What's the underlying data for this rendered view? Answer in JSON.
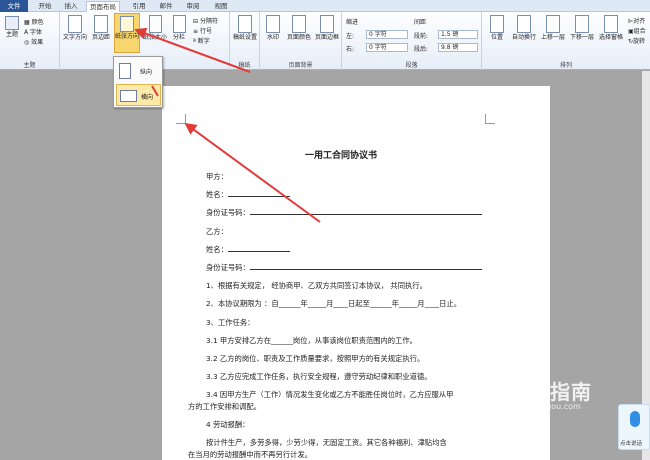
{
  "tabs": [
    "文件",
    "开始",
    "插入",
    "页面布局",
    "引用",
    "邮件",
    "审阅",
    "视图"
  ],
  "ribbon": {
    "theme_group": {
      "label": "主题",
      "theme_btn": "主题",
      "colors": "颜色",
      "fonts": "字体",
      "effects": "效果"
    },
    "page_setup_group": {
      "label": "页面设置",
      "text_direction": "文字方向",
      "margins": "页边距",
      "orientation": "纸张方向",
      "size": "纸张大小",
      "columns": "分栏",
      "breaks": "分隔符",
      "line_numbers": "行号",
      "hyphenation": "断字"
    },
    "manuscript_group": {
      "label": "稿纸",
      "btn": "稿纸设置"
    },
    "page_bg_group": {
      "label": "页面背景",
      "watermark": "水印",
      "page_color": "页面颜色",
      "page_border": "页面边框"
    },
    "paragraph_group": {
      "label": "段落",
      "indent_label": "缩进",
      "spacing_label": "间距",
      "left_label": "左:",
      "left_value": "0 字符",
      "right_label": "右:",
      "right_value": "0 字符",
      "before_label": "段前:",
      "before_value": "1.5 磅",
      "after_label": "段后:",
      "after_value": "9.8 磅"
    },
    "arrange_group": {
      "label": "排列",
      "position": "位置",
      "wrap": "自动换行",
      "bring_forward": "上移一层",
      "send_backward": "下移一层",
      "selection_pane": "选择窗格",
      "align": "对齐",
      "group": "组合",
      "rotate": "旋转"
    }
  },
  "orientation_menu": {
    "portrait": "纵向",
    "landscape": "横向"
  },
  "document": {
    "title": "一用工合同协议书",
    "lines": [
      "甲方：",
      "姓名：",
      "身份证号码：",
      "乙方：",
      "姓名：",
      "身份证号码：",
      "1、根据有关规定，  经协商甲、乙双方共同签订本协议，  共同执行。",
      "2、本协议期限为 ：自______年_____月____日起至______年_____月____日止。",
      "3、工作任务：",
      "3.1 甲方安排乙方在______岗位，从事该岗位职责范围内的工作。",
      "3.2 乙方的岗位、职责及工作质量要求，按照甲方的有关规定执行。",
      "3.3 乙方应完成工作任务，执行安全规程，遵守劳动纪律和职业道德。",
      "3.4 因甲方生产（工作）情况发生变化或乙方不能胜任岗位时，乙方应服从甲",
      "方的工作安排和调配。",
      "4 劳动报酬：",
      "按计件生产，多劳多得，少劳少得，无固定工资。其它各种福利、津贴均含",
      "在当月的劳动报酬中而不再另行计发。"
    ]
  },
  "watermark": {
    "brand": "搜狗指南",
    "url": "zhinan.sogou.com"
  },
  "voice_widget": {
    "label": "点击说话"
  },
  "colors": {
    "file_tab": "#2a5699",
    "highlight": "#f8d66e",
    "arrow": "#e23b3b"
  }
}
